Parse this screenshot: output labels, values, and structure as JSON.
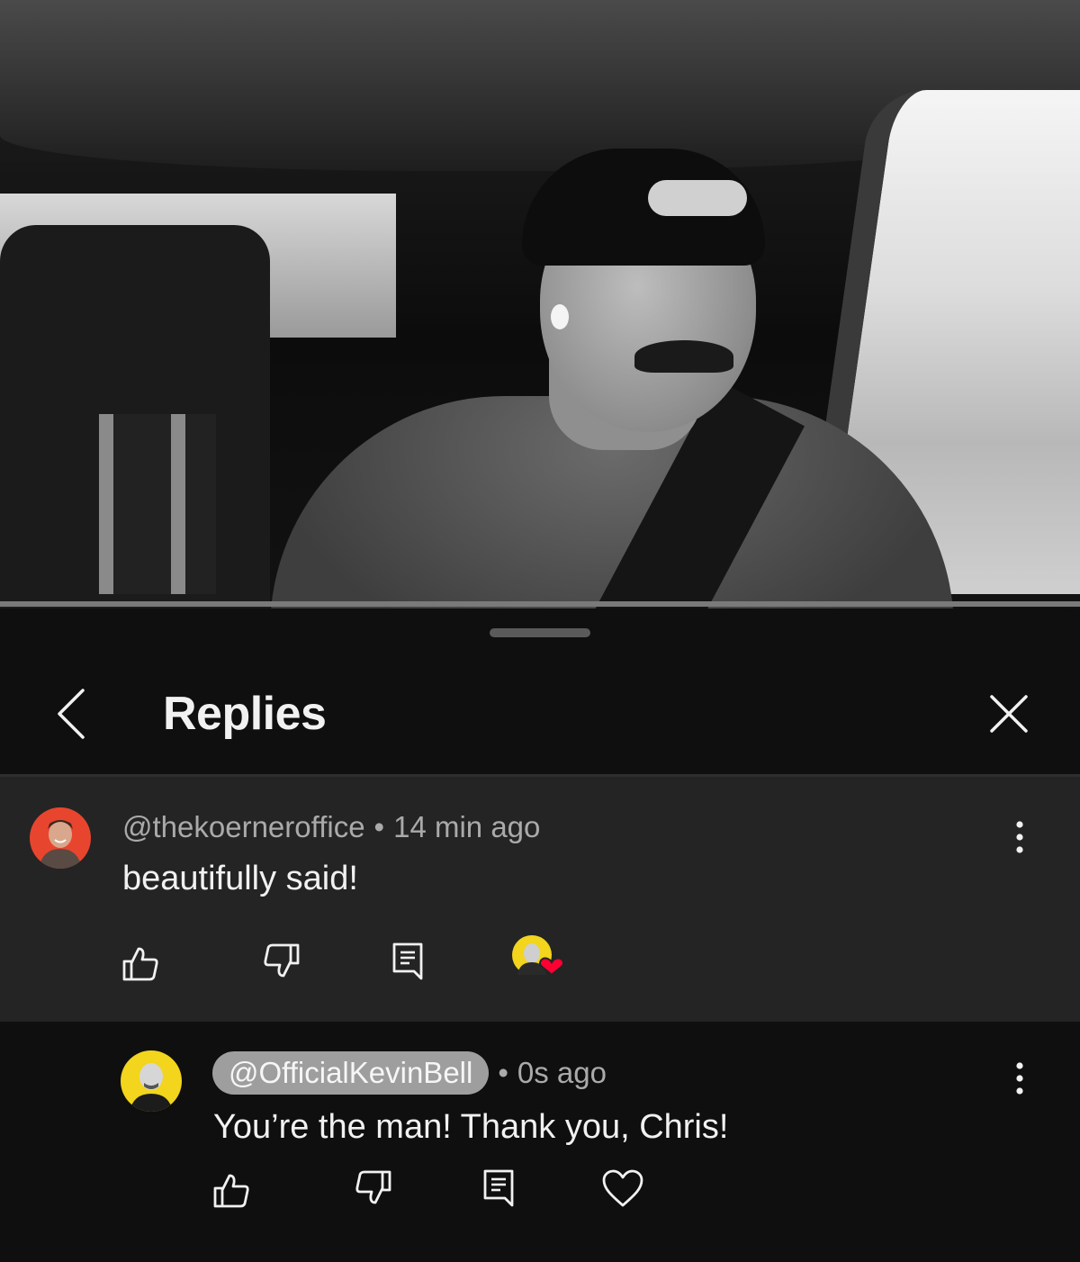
{
  "video": {
    "description_icon": "video-frame"
  },
  "panel": {
    "title": "Replies",
    "back_icon": "chevron-left-icon",
    "close_icon": "close-icon"
  },
  "comment": {
    "author": "@thekoerneroffice",
    "separator": "•",
    "time": "14 min ago",
    "text": "beautifully said!",
    "avatar_color": "#e8452f",
    "actions": [
      "like-icon",
      "dislike-icon",
      "reply-icon",
      "creator-heart-icon"
    ]
  },
  "reply": {
    "author": "@OfficialKevinBell",
    "separator": "•",
    "time": "0s ago",
    "text": "You’re the man! Thank you, Chris!",
    "avatar_color": "#f2d51c",
    "actions": [
      "like-icon",
      "dislike-icon",
      "reply-icon",
      "heart-icon"
    ]
  },
  "colors": {
    "background": "#0f0f0f",
    "highlight": "#242424",
    "heart": "#ff0033",
    "meta": "#aaaaaa"
  }
}
